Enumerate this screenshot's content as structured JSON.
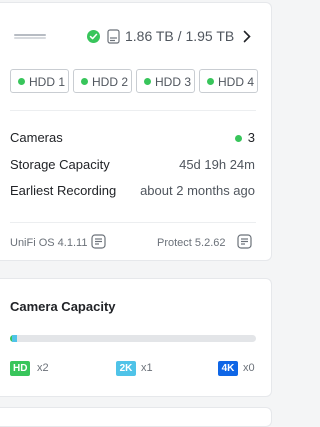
{
  "header": {
    "storage_text": "1.86 TB / 1.95 TB",
    "status": "healthy"
  },
  "hdds": [
    {
      "label": "HDD 1",
      "status_color": "#38c55b"
    },
    {
      "label": "HDD 2",
      "status_color": "#38c55b"
    },
    {
      "label": "HDD 3",
      "status_color": "#38c55b"
    },
    {
      "label": "HDD 4",
      "status_color": "#38c55b"
    }
  ],
  "stats": {
    "cameras_label": "Cameras",
    "cameras_value": "3",
    "storage_capacity_label": "Storage Capacity",
    "storage_capacity_value": "45d 19h 24m",
    "earliest_recording_label": "Earliest Recording",
    "earliest_recording_value": "about 2 months ago"
  },
  "footer": {
    "os_version": "UniFi OS 4.1.11",
    "protect_version": "Protect 5.2.62"
  },
  "camera_capacity": {
    "title": "Camera Capacity",
    "usage": [
      {
        "res": "HD",
        "fraction": 0.012,
        "color": "#38c55b"
      },
      {
        "res": "2K",
        "fraction": 0.02,
        "color": "#4fc3e8"
      }
    ],
    "resolutions": [
      {
        "label": "HD",
        "count": "x2",
        "color": "#38c55b"
      },
      {
        "label": "2K",
        "count": "x1",
        "color": "#4fc3e8"
      },
      {
        "label": "4K",
        "count": "x0",
        "color": "#0f66e6"
      }
    ]
  },
  "colors": {
    "ok": "#38c55b",
    "accent": "#0f66e6"
  }
}
